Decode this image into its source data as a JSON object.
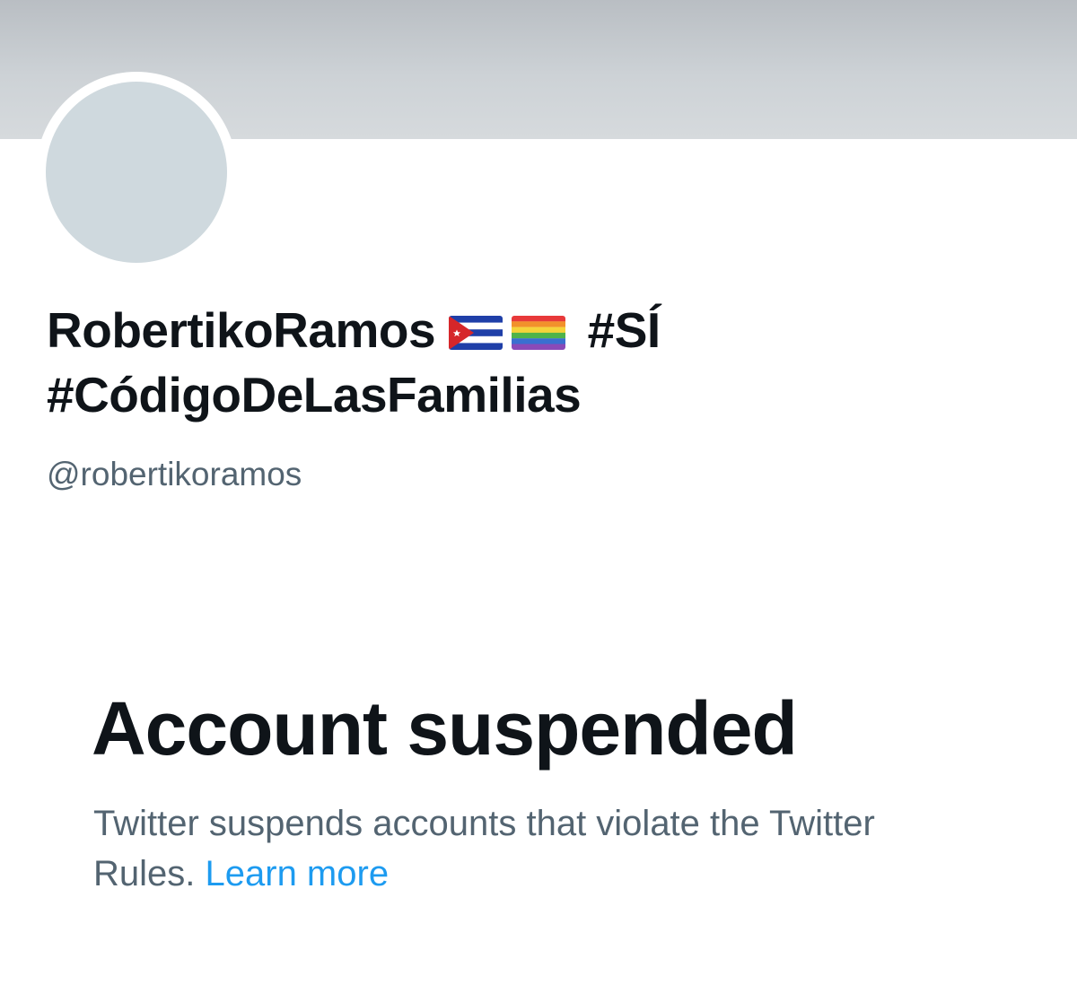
{
  "profile": {
    "name_part1": "RobertikoRamos",
    "flag1_icon": "cuba-flag-icon",
    "flag2_icon": "rainbow-flag-icon",
    "name_part2": "#SÍ",
    "name_line2": "#CódigoDeLasFamilias",
    "handle": "@robertikoramos"
  },
  "suspension": {
    "title": "Account suspended",
    "description": "Twitter suspends accounts that violate the Twitter Rules.",
    "learn_more": "Learn more"
  },
  "colors": {
    "text_primary": "#0f1419",
    "text_secondary": "#536471",
    "link": "#1d9bf0",
    "avatar_placeholder": "#cfd9de"
  }
}
